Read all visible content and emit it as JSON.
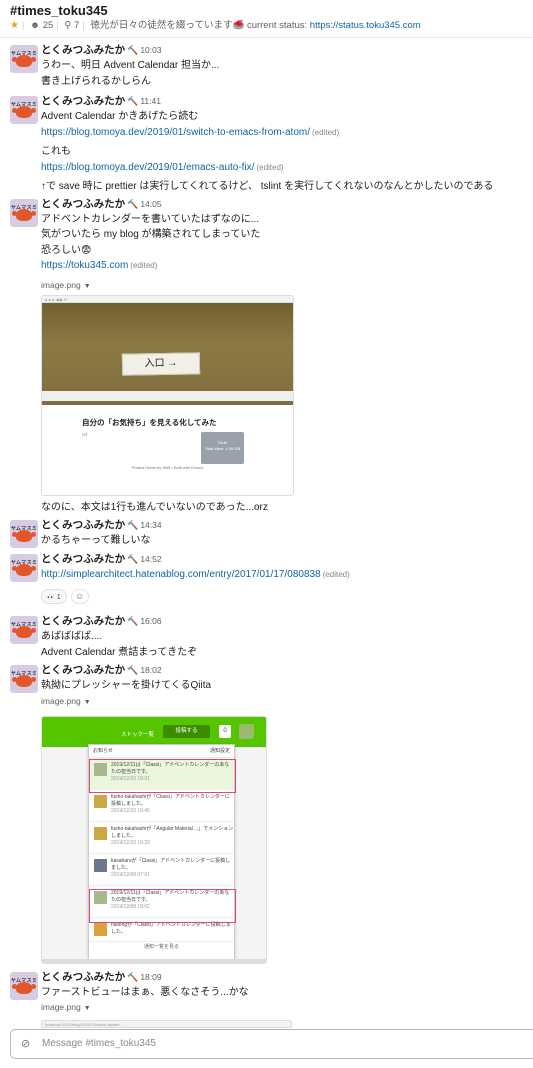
{
  "channel": {
    "name": "#times_toku345",
    "members": "25",
    "pins": "7",
    "topic": "徳光が日々の徒然を綴っています",
    "topic_emoji": "🥌",
    "status_label": "current status:",
    "status_link": "https://status.toku345.com"
  },
  "user": {
    "name": "とくみつふみたか",
    "badge_emoji": "🔨",
    "avatar_label": "ヤムマスミ"
  },
  "messages": [
    {
      "time": "10:03",
      "lines": [
        "うわー、明日 Advent Calendar 担当か...",
        "書き上げられるかしらん"
      ]
    },
    {
      "time": "11:41",
      "line1": "Advent Calendar かきあげたら読む",
      "link1": "https://blog.tomoya.dev/2019/01/switch-to-emacs-from-atom/",
      "edited": "(edited)",
      "line2": "これも",
      "link2": "https://blog.tomoya.dev/2019/01/emacs-auto-fix/",
      "line3": "↑で save 時に prettier は実行してくれてるけど、 tslint を実行してくれないのなんとかしたいのである"
    },
    {
      "time": "14:05",
      "line1": "アドベントカレンダーを書いていたはずなのに...",
      "line2": "気がついたら my blog が構築されてしまっていた",
      "line3": "恐ろしい😨",
      "link1": "https://toku345.com",
      "edited": "(edited)",
      "file": "image.png",
      "after": "なのに、本文は1行も進んでいないのであった...orz"
    },
    {
      "time": "14:34",
      "line1": "かるちゃーって難しいな"
    },
    {
      "time": "14:52",
      "link1": "http://simplearchitect.hatenablog.com/entry/2017/01/17/080838",
      "edited": "(edited)",
      "reaction_emoji": "👀",
      "reaction_count": "1",
      "add_reaction_icon": "add-reaction-icon"
    },
    {
      "time": "16:06",
      "line1": "あばばばば....",
      "line2": "Advent Calendar 煮詰まってきたぞ"
    },
    {
      "time": "18:02",
      "line1": "執拗にプレッシャーを掛けてくるQiita",
      "file": "image.png"
    },
    {
      "time": "18:09",
      "line1": "ファーストビューはまぁ、悪くなさそう...かな",
      "file": "image.png"
    }
  ],
  "shot1": {
    "sign": "入口 →",
    "post_title": "自分の「お気持ち」を見える化してみた",
    "post_tag": "ref",
    "ram_label": "RAM",
    "ram_usage": "Total Mem: 4.59 GB",
    "footer": "Posted Home by Shift • Built with Emacs"
  },
  "shot2": {
    "stock": "ストック一覧",
    "post_button": "投稿する",
    "notif_count": "0",
    "panel_title": "お知らせ",
    "panel_settings": "通知設定",
    "items": [
      {
        "text": "2019/12/11は「Classi」アドベントカレンダーのあなたの担当日です。",
        "date": "2019/12/10 18:01"
      },
      {
        "text": "fusho-takahashiが「Classi」アドベントカレンダーに投稿しました。",
        "date": "2019/12/10 16:45"
      },
      {
        "text": "fusho-takahashiが「Angular Material ...」でメンションしました。",
        "date": "2019/12/10 16:32"
      },
      {
        "text": "kasaharuが「Classi」アドベントカレンダーに投稿しました。",
        "date": "2019/12/09 07:01"
      },
      {
        "text": "2019/12/11は「Classi」アドベントカレンダーのあなたの担当日です。",
        "date": "2019/12/08 18:02"
      },
      {
        "text": "hailongが「Classi」アドベントカレンダーに投稿しました。",
        "date": ""
      }
    ],
    "see_all": "通知一覧を見る"
  },
  "shot3": {
    "url": "localhost:1313/blog/2019/12/classi-advent..."
  },
  "composer": {
    "placeholder": "Message #times_toku345"
  },
  "colors": {
    "link": "#1264a3",
    "qiita_green": "#55c500",
    "highlight_box": "#e3447a",
    "star": "#e8a723"
  }
}
